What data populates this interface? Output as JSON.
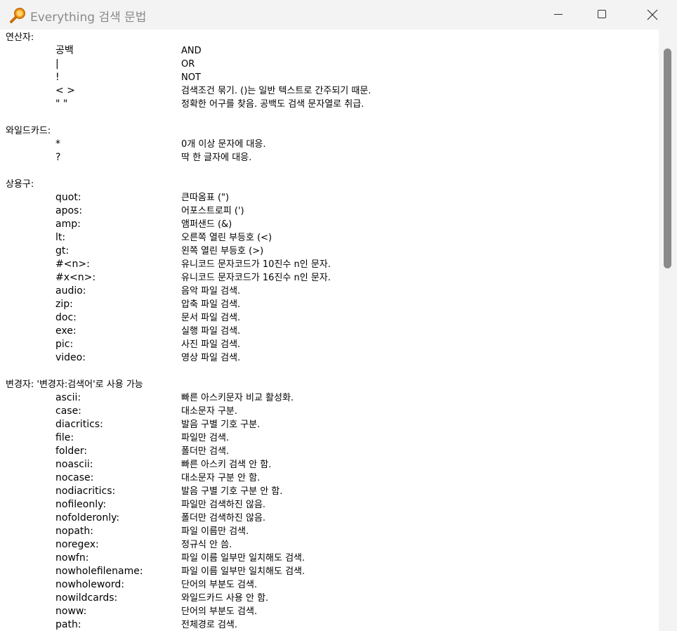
{
  "window": {
    "title": "Everything 검색 문법"
  },
  "sections": [
    {
      "title": "연산자:",
      "rows": [
        {
          "key": "공백",
          "desc": "AND"
        },
        {
          "key": "|",
          "desc": "OR"
        },
        {
          "key": "!",
          "desc": "NOT"
        },
        {
          "key": "< >",
          "desc": "검색조건 묶기. ()는 일반 텍스트로 간주되기 때문."
        },
        {
          "key": "\" \"",
          "desc": "정확한 어구를 찾음. 공백도 검색 문자열로 취급."
        }
      ]
    },
    {
      "title": "와일드카드:",
      "rows": [
        {
          "key": "*",
          "desc": "0개 이상 문자에 대응."
        },
        {
          "key": "?",
          "desc": "딱 한 글자에 대응."
        }
      ]
    },
    {
      "title": "상용구:",
      "rows": [
        {
          "key": "quot:",
          "desc": "큰따옴표 (\")"
        },
        {
          "key": "apos:",
          "desc": "어포스트로피 (')"
        },
        {
          "key": "amp:",
          "desc": "앰퍼샌드 (&)"
        },
        {
          "key": "lt:",
          "desc": "오른쪽 열린 부등호 (<)"
        },
        {
          "key": "gt:",
          "desc": "왼쪽 열린 부등호 (>)"
        },
        {
          "key": "#<n>:",
          "desc": "유니코드 문자코드가 10진수 n인 문자."
        },
        {
          "key": "#x<n>:",
          "desc": "유니코드 문자코드가 16진수 n인 문자."
        },
        {
          "key": "audio:",
          "desc": "음악 파일 검색."
        },
        {
          "key": "zip:",
          "desc": "압축 파일 검색."
        },
        {
          "key": "doc:",
          "desc": "문서 파일 검색."
        },
        {
          "key": "exe:",
          "desc": "실행 파일 검색."
        },
        {
          "key": "pic:",
          "desc": "사진 파일 검색."
        },
        {
          "key": "video:",
          "desc": "영상 파일 검색."
        }
      ]
    },
    {
      "title": "변경자: '변경자:검색어'로 사용 가능",
      "rows": [
        {
          "key": "ascii:",
          "desc": "빠른 아스키문자 비교 활성화."
        },
        {
          "key": "case:",
          "desc": "대소문자 구분."
        },
        {
          "key": "diacritics:",
          "desc": "발음 구별 기호 구분."
        },
        {
          "key": "file:",
          "desc": "파일만 검색."
        },
        {
          "key": "folder:",
          "desc": "폴더만 검색."
        },
        {
          "key": "noascii:",
          "desc": "빠른 아스키 검색 안 함."
        },
        {
          "key": "nocase:",
          "desc": "대소문자 구분 안 함."
        },
        {
          "key": "nodiacritics:",
          "desc": "발음 구별 기호 구분 안 함."
        },
        {
          "key": "nofileonly:",
          "desc": "파일만 검색하진 않음."
        },
        {
          "key": "nofolderonly:",
          "desc": "폴더만 검색하진 않음."
        },
        {
          "key": "nopath:",
          "desc": "파일 이름만 검색."
        },
        {
          "key": "noregex:",
          "desc": "정규식 안 씀."
        },
        {
          "key": "nowfn:",
          "desc": "파일 이름 일부만 일치해도 검색."
        },
        {
          "key": "nowholefilename:",
          "desc": "파일 이름 일부만 일치해도 검색."
        },
        {
          "key": "nowholeword:",
          "desc": "단어의 부분도 검색."
        },
        {
          "key": "nowildcards:",
          "desc": "와일드카드 사용 안 함."
        },
        {
          "key": "noww:",
          "desc": "단어의 부분도 검색."
        },
        {
          "key": "path:",
          "desc": "전체경로 검색."
        }
      ]
    }
  ]
}
